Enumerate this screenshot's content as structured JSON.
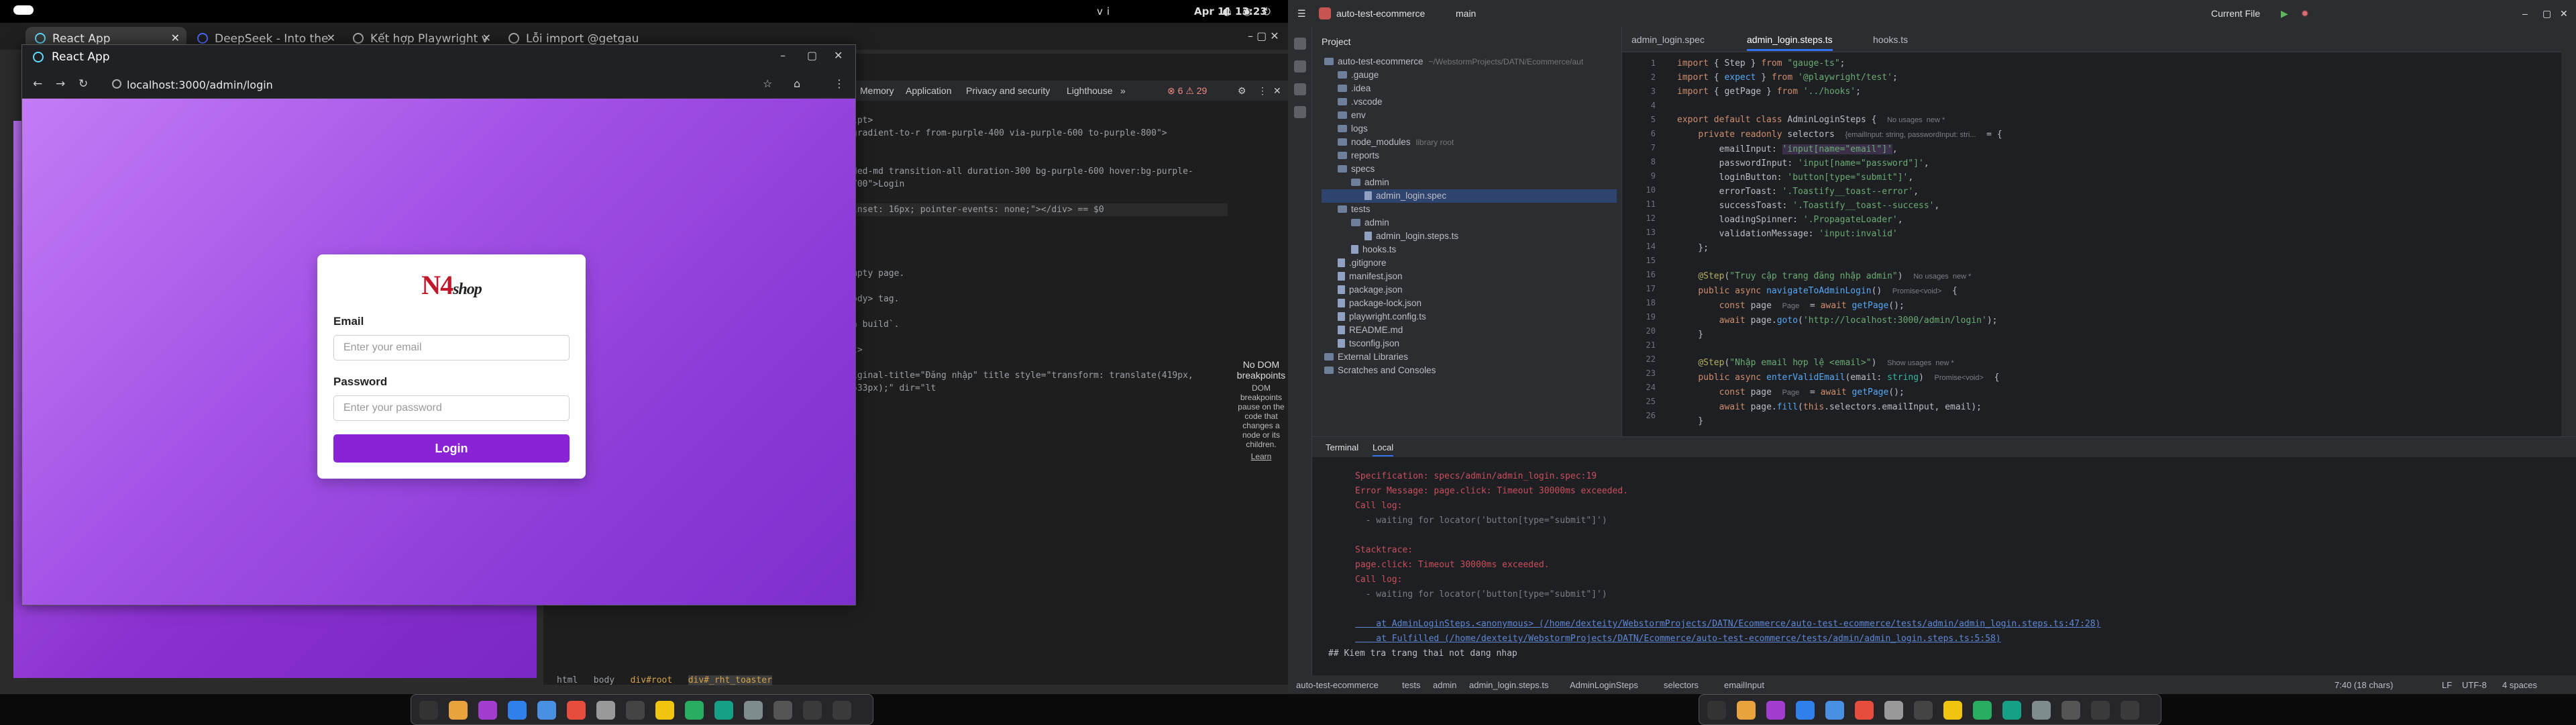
{
  "topbar": {
    "date_time": "Apr 11  13:23",
    "lang": "vi"
  },
  "browser": {
    "tabs": [
      {
        "label": "React App",
        "active": true
      },
      {
        "label": "DeepSeek - Into the",
        "active": false
      },
      {
        "label": "Kết hợp Playwright v",
        "active": false
      },
      {
        "label": "Lỗi import @getgau",
        "active": false
      }
    ]
  },
  "popup": {
    "title": "React App",
    "url": "localhost:3000/admin/login",
    "logo_brand": "N4",
    "logo_shop": "shop",
    "email_label": "Email",
    "email_placeholder": "Enter your email",
    "password_label": "Password",
    "password_placeholder": "Enter your password",
    "login_button": "Login",
    "colors": {
      "accent": "#8a22d6",
      "logo_red": "#c0182a"
    }
  },
  "devtools": {
    "tabs": [
      "Memory",
      "Application",
      "Privacy and security",
      "Lighthouse",
      "»"
    ],
    "code_lines": [
      "ipt>",
      "gradient-to-r from-purple-400 via-purple-600 to-purple-800\">",
      "",
      "ded-md transition-all duration-300 bg-purple-600 hover:bg-purple-700\">Login",
      "",
      " inset: 16px; pointer-events: none;\"></div> == $0",
      "",
      "mpty page.",
      "ody> tag.",
      "n build`.",
      "t>",
      "iginal-title=\"Đăng nhập\" title style=\"transform: translate(419px, 533px);\" dir=\"lt"
    ],
    "no_dom_title": "No DOM breakpoints",
    "no_dom_text": "DOM breakpoints pause on the code that changes a node or its children.",
    "learn_more": "Learn",
    "breadcrumbs": [
      "html",
      "body",
      "div#root",
      "div#_rht_toaster"
    ]
  },
  "ide": {
    "project_name": "auto-test-ecommerce",
    "branch": "main",
    "run_config": "Current File",
    "project_label": "Project",
    "tree": [
      {
        "label": "auto-test-ecommerce",
        "extra": "~/WebstormProjects/DATN/Ecommerce/aut",
        "depth": 0,
        "type": "folder"
      },
      {
        "label": ".gauge",
        "extra": "",
        "depth": 1,
        "type": "folder"
      },
      {
        "label": ".idea",
        "extra": "",
        "depth": 1,
        "type": "folder"
      },
      {
        "label": ".vscode",
        "extra": "",
        "depth": 1,
        "type": "folder"
      },
      {
        "label": "env",
        "extra": "",
        "depth": 1,
        "type": "folder"
      },
      {
        "label": "logs",
        "extra": "",
        "depth": 1,
        "type": "folder"
      },
      {
        "label": "node_modules",
        "extra": "library root",
        "depth": 1,
        "type": "folder"
      },
      {
        "label": "reports",
        "extra": "",
        "depth": 1,
        "type": "folder"
      },
      {
        "label": "specs",
        "extra": "",
        "depth": 1,
        "type": "folder"
      },
      {
        "label": "admin",
        "extra": "",
        "depth": 2,
        "type": "folder"
      },
      {
        "label": "admin_login.spec",
        "extra": "",
        "depth": 3,
        "type": "file",
        "selected": true
      },
      {
        "label": "tests",
        "extra": "",
        "depth": 1,
        "type": "folder"
      },
      {
        "label": "admin",
        "extra": "",
        "depth": 2,
        "type": "folder"
      },
      {
        "label": "admin_login.steps.ts",
        "extra": "",
        "depth": 3,
        "type": "file"
      },
      {
        "label": "hooks.ts",
        "extra": "",
        "depth": 2,
        "type": "file"
      },
      {
        "label": ".gitignore",
        "extra": "",
        "depth": 1,
        "type": "file"
      },
      {
        "label": "manifest.json",
        "extra": "",
        "depth": 1,
        "type": "file"
      },
      {
        "label": "package.json",
        "extra": "",
        "depth": 1,
        "type": "file"
      },
      {
        "label": "package-lock.json",
        "extra": "",
        "depth": 1,
        "type": "file"
      },
      {
        "label": "playwright.config.ts",
        "extra": "",
        "depth": 1,
        "type": "file"
      },
      {
        "label": "README.md",
        "extra": "",
        "depth": 1,
        "type": "file"
      },
      {
        "label": "tsconfig.json",
        "extra": "",
        "depth": 1,
        "type": "file"
      },
      {
        "label": "External Libraries",
        "extra": "",
        "depth": 0,
        "type": "folder"
      },
      {
        "label": "Scratches and Consoles",
        "extra": "",
        "depth": 0,
        "type": "folder"
      }
    ],
    "editor_tabs": [
      "admin_login.spec",
      "admin_login.steps.ts",
      "hooks.ts"
    ],
    "line_numbers": [
      "1",
      "2",
      "3",
      "4",
      "5",
      "6",
      "7",
      "8",
      "9",
      "10",
      "11",
      "12",
      "13",
      "14",
      "15",
      "16",
      "17",
      "18",
      "19",
      "20",
      "21",
      "22",
      "23",
      "24",
      "25",
      "26"
    ],
    "terminal_tabs": [
      "Terminal",
      "Local"
    ],
    "terminal_lines": [
      "Specification: specs/admin/admin_login.spec:19",
      "Error Message: page.click: Timeout 30000ms exceeded.",
      "Call log:",
      "  - waiting for locator('button[type=\"submit\"]')",
      "",
      "Stacktrace:",
      "page.click: Timeout 30000ms exceeded.",
      "Call log:",
      "  - waiting for locator('button[type=\"submit\"]')",
      "",
      "    at AdminLoginSteps.<anonymous> (/home/dexteity/WebstormProjects/DATN/Ecommerce/auto-test-ecommerce/tests/admin/admin_login.steps.ts:47:28)",
      "    at Fulfilled (/home/dexteity/WebstormProjects/DATN/Ecommerce/auto-test-ecommerce/tests/admin/admin_login.steps.ts:5:58)"
    ],
    "terminal_prompt": "## Kiem tra trang thai not dang nhap",
    "status_path": [
      "auto-test-ecommerce",
      "tests",
      "admin",
      "admin_login.steps.ts",
      "AdminLoginSteps",
      "selectors",
      "emailInput"
    ],
    "status_right": [
      "7:40 (18 chars)",
      "LF",
      "UTF-8",
      "4 spaces"
    ]
  }
}
